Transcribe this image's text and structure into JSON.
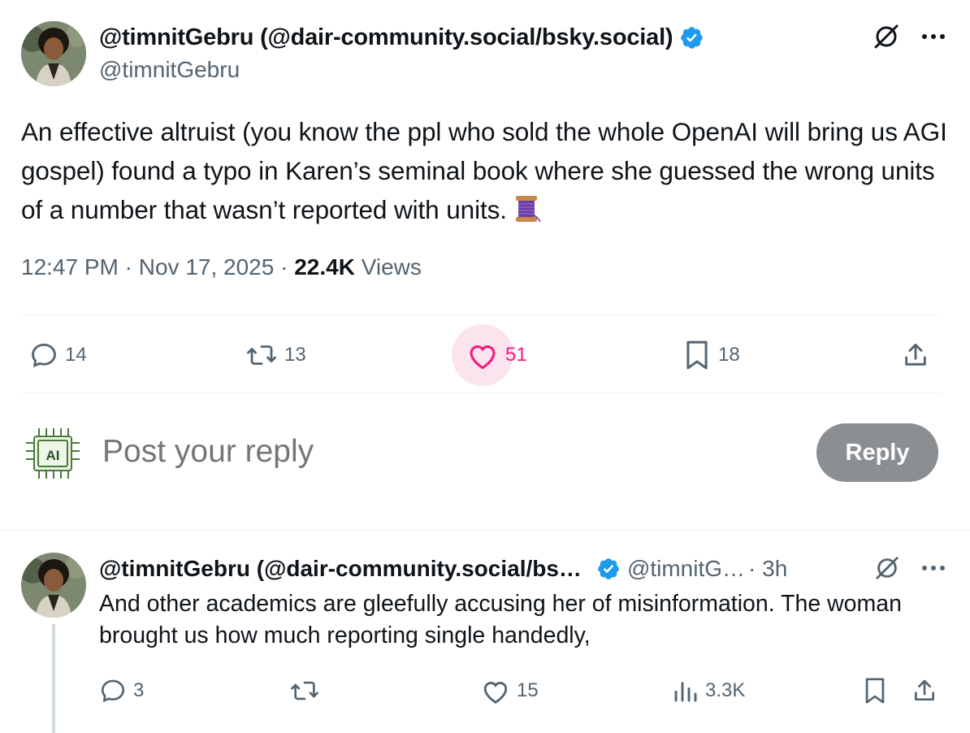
{
  "main_tweet": {
    "display_name": "@timnitGebru (@dair-community.social/bsky.social)",
    "handle": "@timnitGebru",
    "text": "An effective altruist (you know the ppl who sold the whole OpenAI will bring us AGI gospel) found a typo in Karen’s seminal book where she guessed the wrong units of a number that wasn’t reported with units.",
    "emoji": "spool-of-thread-icon",
    "time": "12:47 PM",
    "separator": " · ",
    "date": "Nov 17, 2025",
    "views_count": "22.4K",
    "views_label": " Views",
    "stats": {
      "replies": "14",
      "reposts": "13",
      "likes": "51",
      "bookmarks": "18"
    }
  },
  "composer": {
    "placeholder": "Post your reply",
    "avatar_icon_text": "AI",
    "reply_button": "Reply"
  },
  "reply_tweet": {
    "display_name": "@timnitGebru (@dair-community.social/bs…",
    "handle": "@timnitG…",
    "time": "· 3h",
    "text": "And other academics are gleefully accusing her of misinformation. The woman brought us how much reporting single handedly,",
    "stats": {
      "replies": "3",
      "likes": "15",
      "views": "3.3K"
    }
  },
  "colors": {
    "text": "#0f1419",
    "secondary": "#536471",
    "like": "#f91880",
    "like_bg": "#fce4ef",
    "verified": "#1d9bf0",
    "divider": "#eff3f4",
    "reply_button_bg": "#8b8f92"
  }
}
